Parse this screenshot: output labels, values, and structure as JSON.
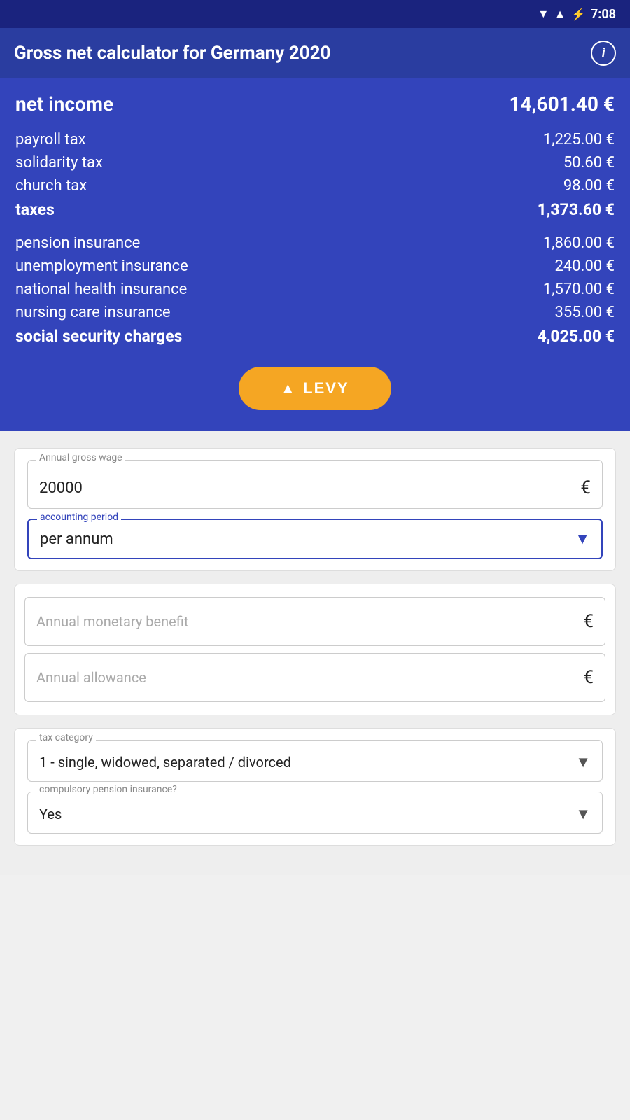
{
  "statusBar": {
    "time": "7:08",
    "wifiIcon": "▼",
    "signalIcon": "▲",
    "batteryIcon": "🔋"
  },
  "header": {
    "title": "Gross net calculator for Germany 2020",
    "infoLabel": "i"
  },
  "results": {
    "netIncomeLabel": "net income",
    "netIncomeValue": "14,601.40 €",
    "rows": [
      {
        "label": "payroll tax",
        "value": "1,225.00 €",
        "subtotal": false
      },
      {
        "label": "solidarity tax",
        "value": "50.60 €",
        "subtotal": false
      },
      {
        "label": "church tax",
        "value": "98.00 €",
        "subtotal": false
      },
      {
        "label": "taxes",
        "value": "1,373.60 €",
        "subtotal": true
      },
      {
        "label": "pension insurance",
        "value": "1,860.00 €",
        "subtotal": false
      },
      {
        "label": "unemployment insurance",
        "value": "240.00 €",
        "subtotal": false
      },
      {
        "label": "national health insurance",
        "value": "1,570.00 €",
        "subtotal": false
      },
      {
        "label": "nursing care insurance",
        "value": "355.00 €",
        "subtotal": false
      },
      {
        "label": "social security charges",
        "value": "4,025.00 €",
        "subtotal": true
      }
    ],
    "levyButton": "LEVY"
  },
  "form": {
    "annualGrossWageLabel": "Annual gross wage",
    "annualGrossWageValue": "20000",
    "euroSymbol": "€",
    "accountingPeriodLabel": "accounting period",
    "accountingPeriodValue": "per annum",
    "annualMonetaryBenefitPlaceholder": "Annual monetary benefit",
    "annualAllowancePlaceholder": "Annual allowance",
    "taxCategoryLabel": "tax category",
    "taxCategoryValue": "1 - single, widowed, separated / divorced",
    "compulsoryPensionLabel": "compulsory pension insurance?",
    "compulsoryPensionValue": "Yes"
  }
}
